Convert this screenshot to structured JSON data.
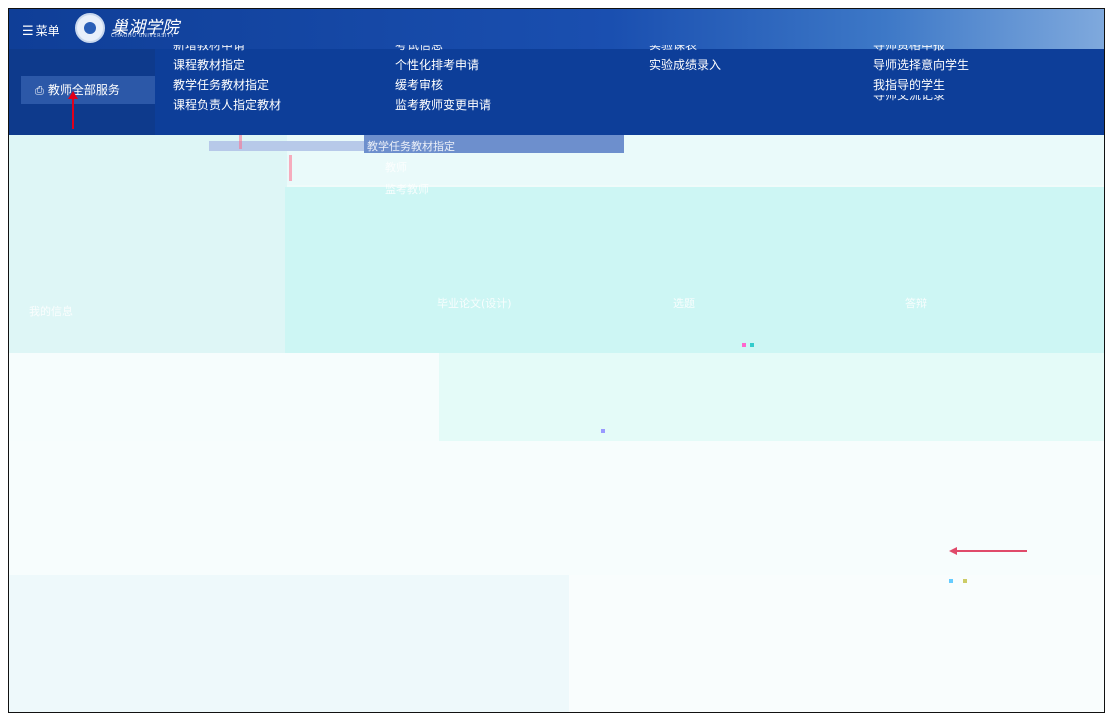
{
  "topbar": {
    "menu_icon": "hamburger-icon",
    "menu_label": "菜单",
    "logo_text": "巢湖学院",
    "logo_en": "CHAOHU UNIVERSITY"
  },
  "sidebar": {
    "active_item": {
      "icon": "document-icon",
      "label": "教师全部服务"
    }
  },
  "mega_menu": {
    "col1": [
      "新增教材申请",
      "课程教材指定",
      "教学任务教材指定",
      "课程负责人指定教材"
    ],
    "col2": [
      "考试信息",
      "个性化排考申请",
      "缓考审核",
      "监考教师变更申请"
    ],
    "col3": [
      "实验课表",
      "实验成绩录入"
    ],
    "col4": [
      "导师资格申报",
      "导师选择意向学生",
      "我指导的学生",
      "导师交流记录"
    ]
  },
  "ghost": {
    "text_a": "教学任务教材指定",
    "text_b": "教师",
    "text_c": "监考教师",
    "text_d": "毕业论文(设计)",
    "text_e": "选题",
    "text_f": "答辩",
    "text_g": "我的信息"
  },
  "colors": {
    "topbar": "#0f3e97",
    "menu_bg": "#0d3e99",
    "sidebar_active": "#2c58a8",
    "annotation_red": "#e0001b"
  }
}
